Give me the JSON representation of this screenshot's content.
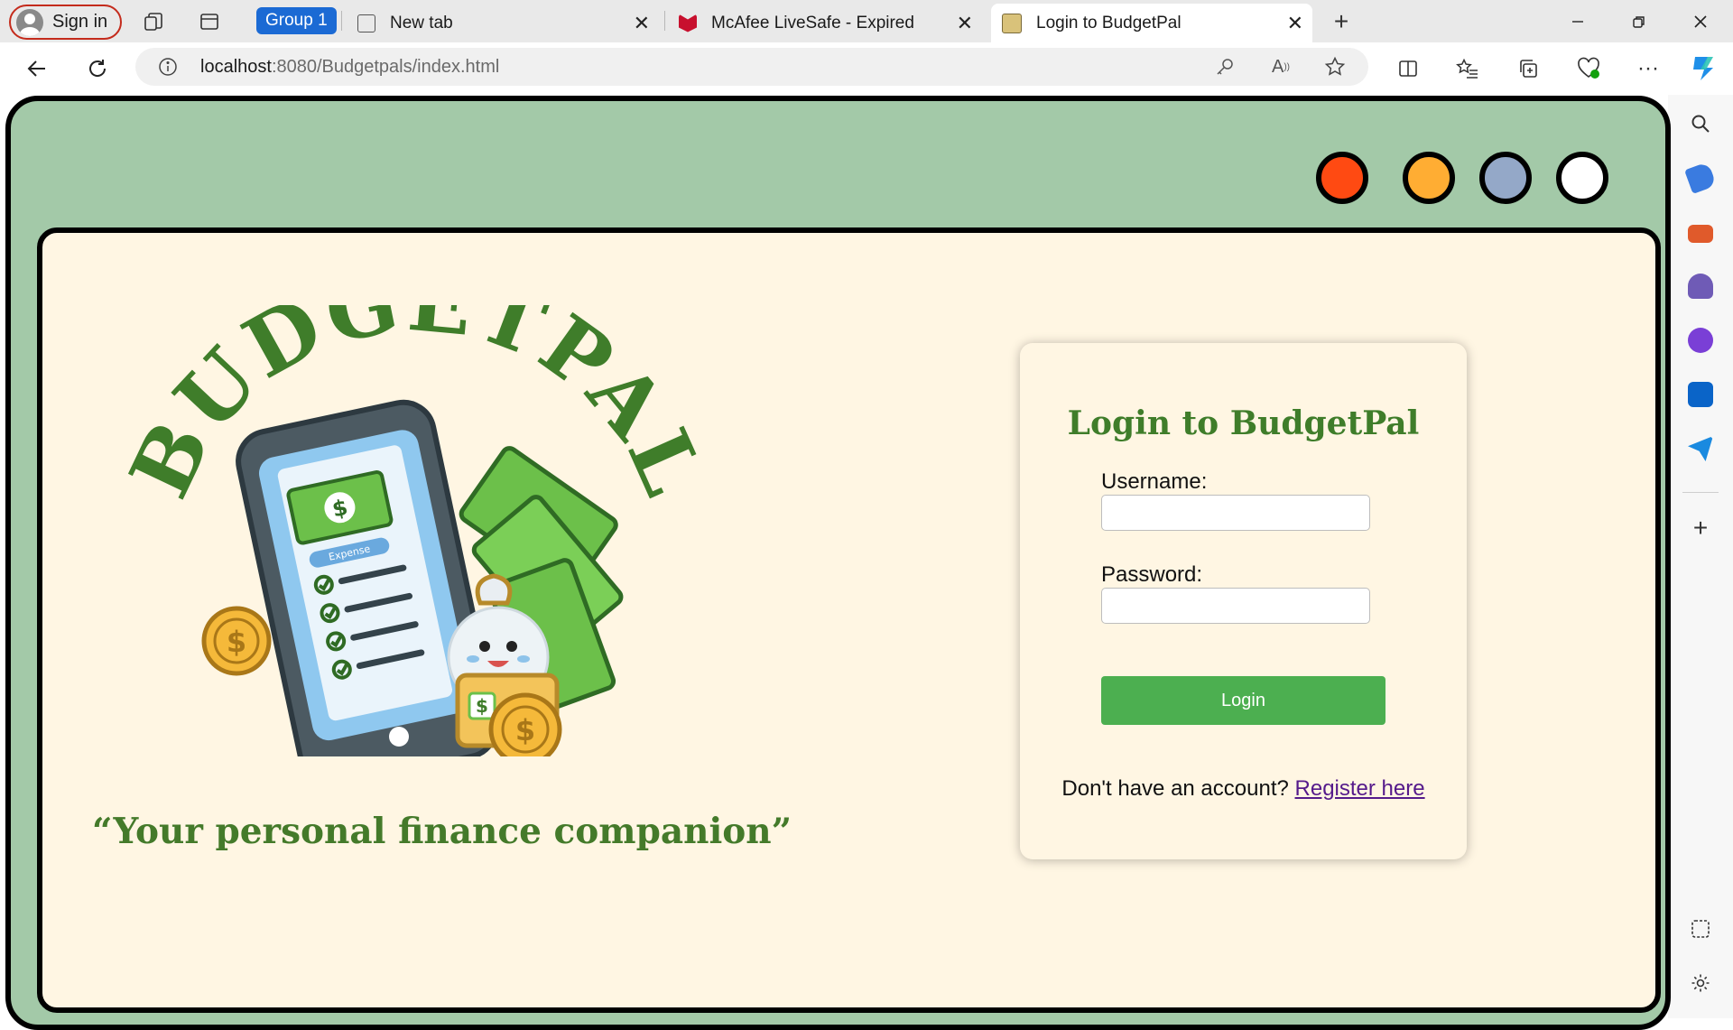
{
  "browser": {
    "sign_in_label": "Sign in",
    "group_label": "Group 1",
    "tabs": [
      {
        "title": "New tab"
      },
      {
        "title": "McAfee LiveSafe - Expired"
      },
      {
        "title": "Login to BudgetPal"
      }
    ],
    "url_host": "localhost",
    "url_path": ":8080/Budgetpals/index.html"
  },
  "colors": {
    "frame_green": "#a3c9a8",
    "page_cream": "#fff6e3",
    "brand_green": "#3f7d2a",
    "button_green": "#4caf50",
    "dots": [
      "#ff4a12",
      "#ffad33",
      "#94a8c8",
      "#ffffff"
    ]
  },
  "logo": {
    "wordmark": "BUDGETPAL",
    "tagline": "“Your personal finance companion”",
    "illustration_icons": [
      "phone-icon",
      "money-bills-icon",
      "coin-icon",
      "checklist-icon",
      "money-bag-mascot-icon"
    ],
    "checklist_tag": "Expense"
  },
  "login": {
    "title": "Login to BudgetPal",
    "username_label": "Username:",
    "password_label": "Password:",
    "submit_label": "Login",
    "register_prompt": "Don't have an account?",
    "register_link": "Register here"
  }
}
